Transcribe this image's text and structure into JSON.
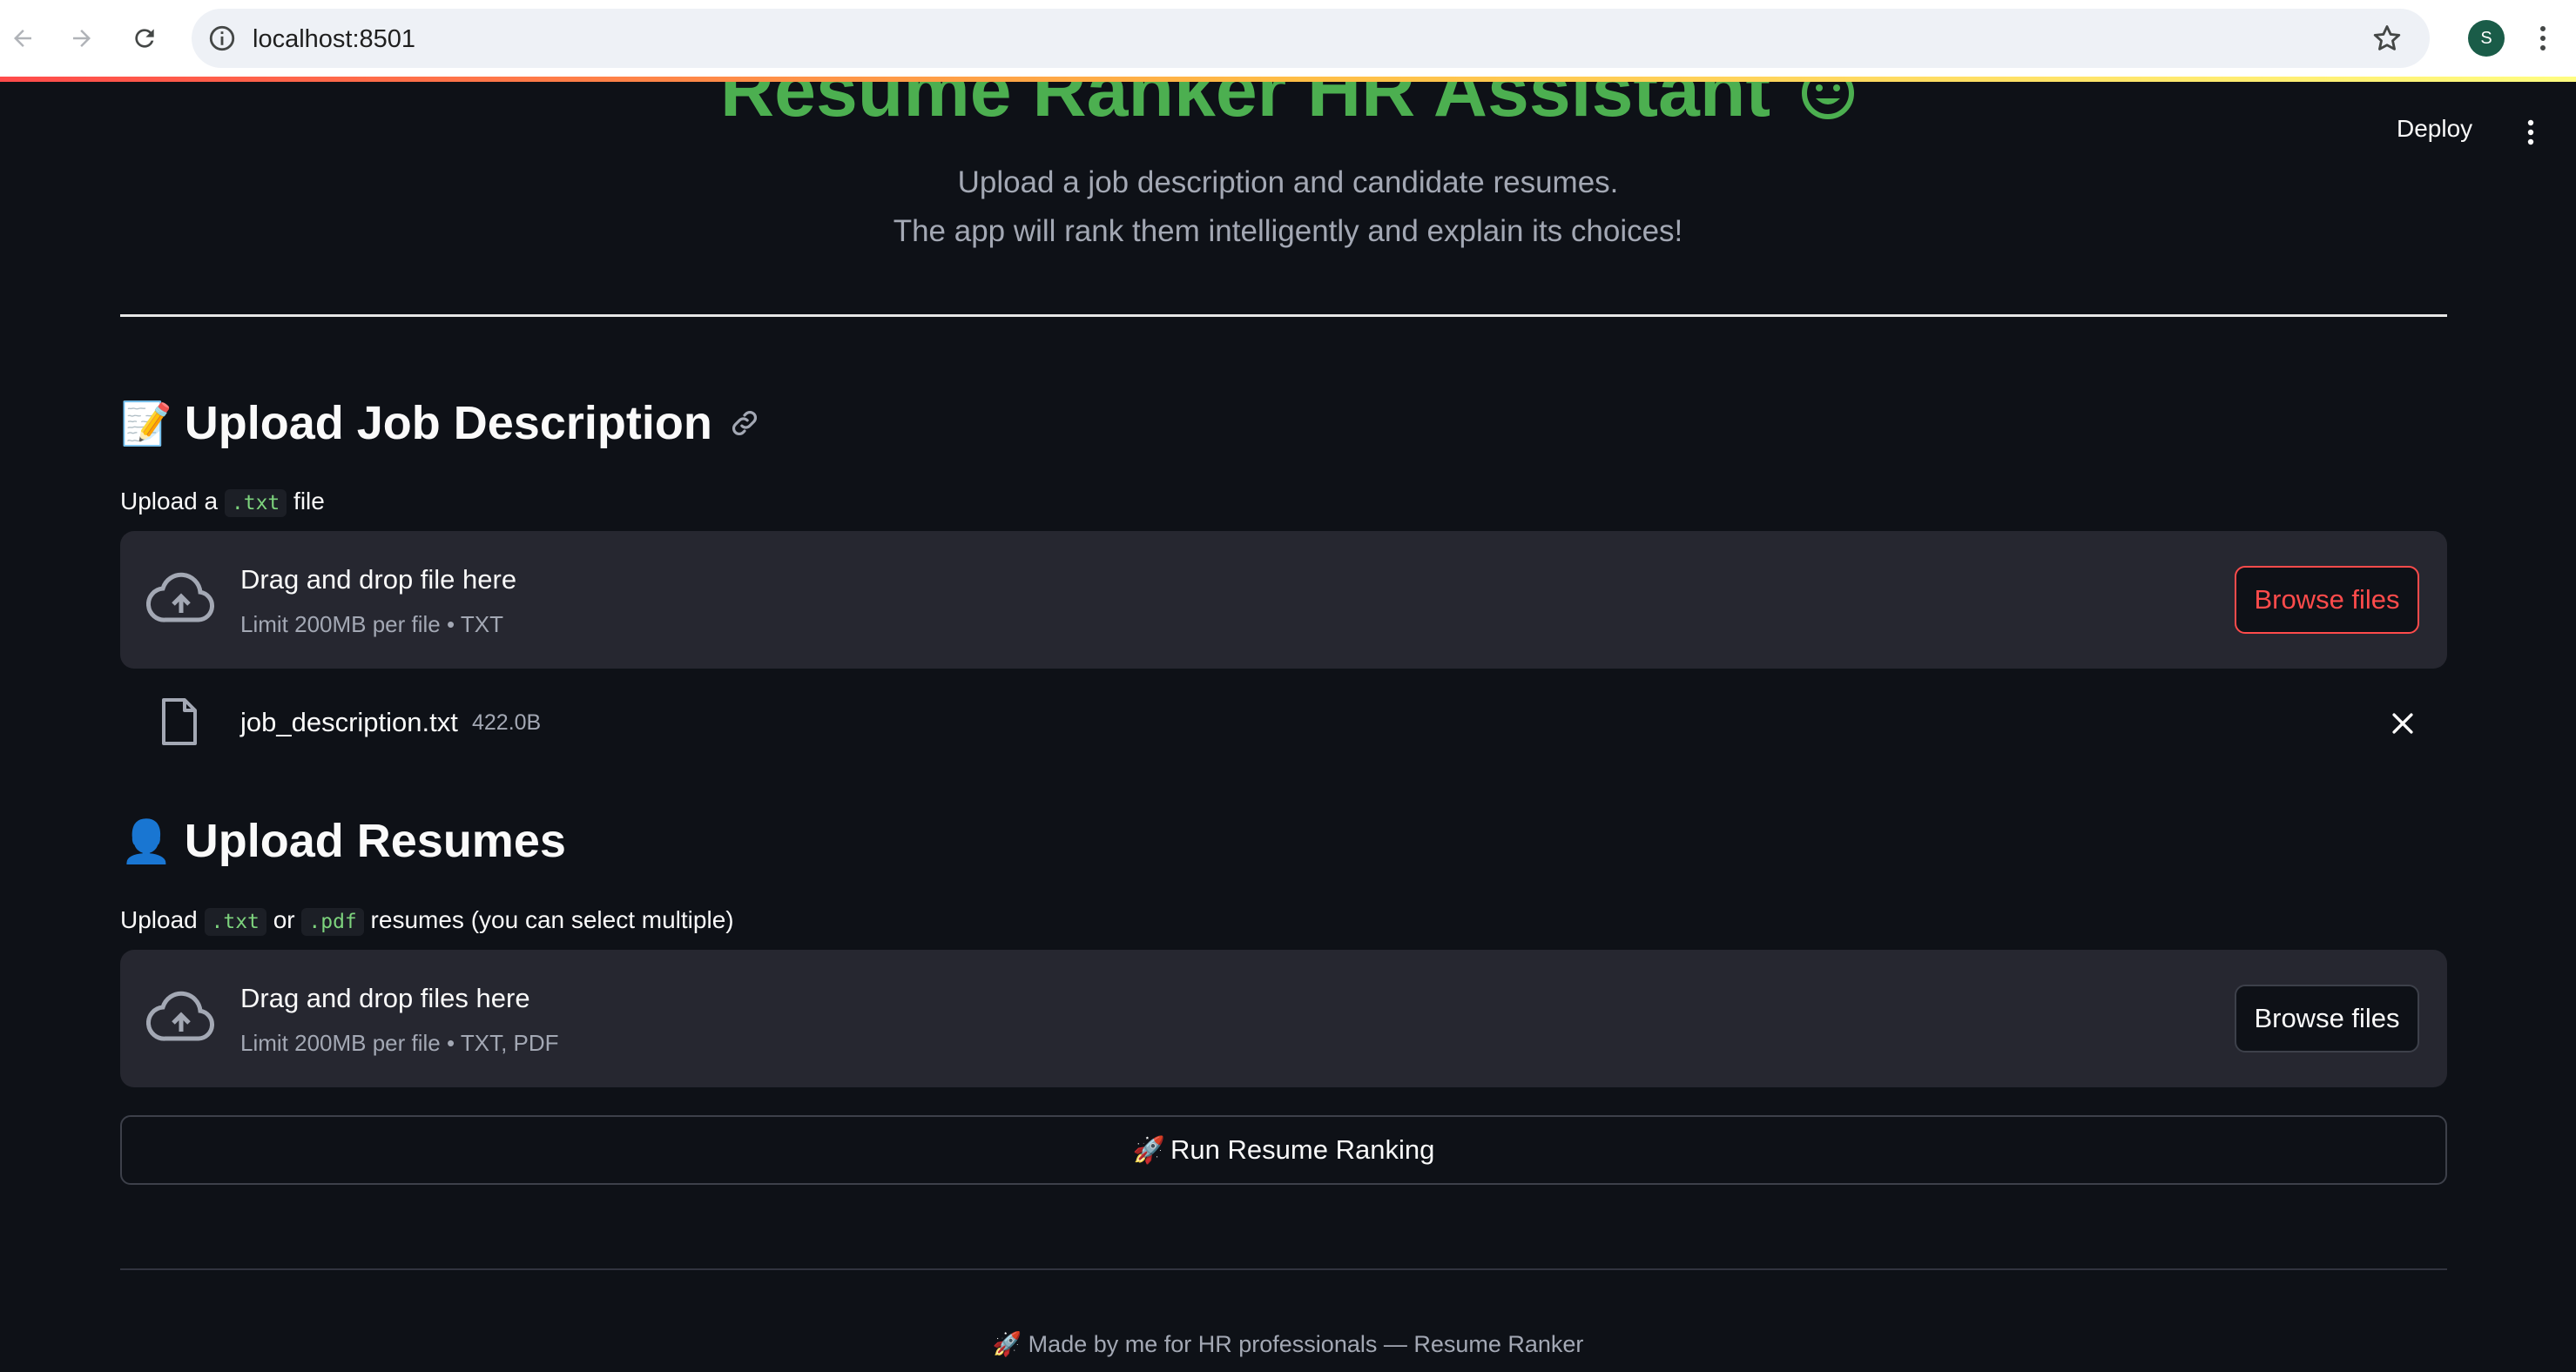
{
  "browser": {
    "url": "localhost:8501",
    "profile_initial": "S"
  },
  "app": {
    "title": "Resume Ranker HR Assistant",
    "deploy_label": "Deploy",
    "subtitle_line1": "Upload a job description and candidate resumes.",
    "subtitle_line2": "The app will rank them intelligently and explain its choices!"
  },
  "job_section": {
    "emoji": "📝",
    "heading": "Upload Job Description",
    "label_prefix": "Upload a",
    "label_code": ".txt",
    "label_suffix": "file",
    "dropzone_title": "Drag and drop file here",
    "dropzone_limit": "Limit 200MB per file • TXT",
    "browse_label": "Browse files",
    "uploaded_file": {
      "name": "job_description.txt",
      "size": "422.0B"
    }
  },
  "resume_section": {
    "emoji": "👤",
    "heading": "Upload Resumes",
    "label_prefix": "Upload",
    "label_code1": ".txt",
    "label_or": "or",
    "label_code2": ".pdf",
    "label_suffix": "resumes (you can select multiple)",
    "dropzone_title": "Drag and drop files here",
    "dropzone_limit": "Limit 200MB per file • TXT, PDF",
    "browse_label": "Browse files"
  },
  "run_button": {
    "emoji": "🚀",
    "label": "Run Resume Ranking"
  },
  "footer": {
    "text": "🚀 Made by me for HR professionals — Resume Ranker"
  },
  "colors": {
    "background": "#0e1117",
    "title_green": "#4caf50",
    "accent_red": "#ff4b4b",
    "dropzone_bg": "#262730"
  }
}
